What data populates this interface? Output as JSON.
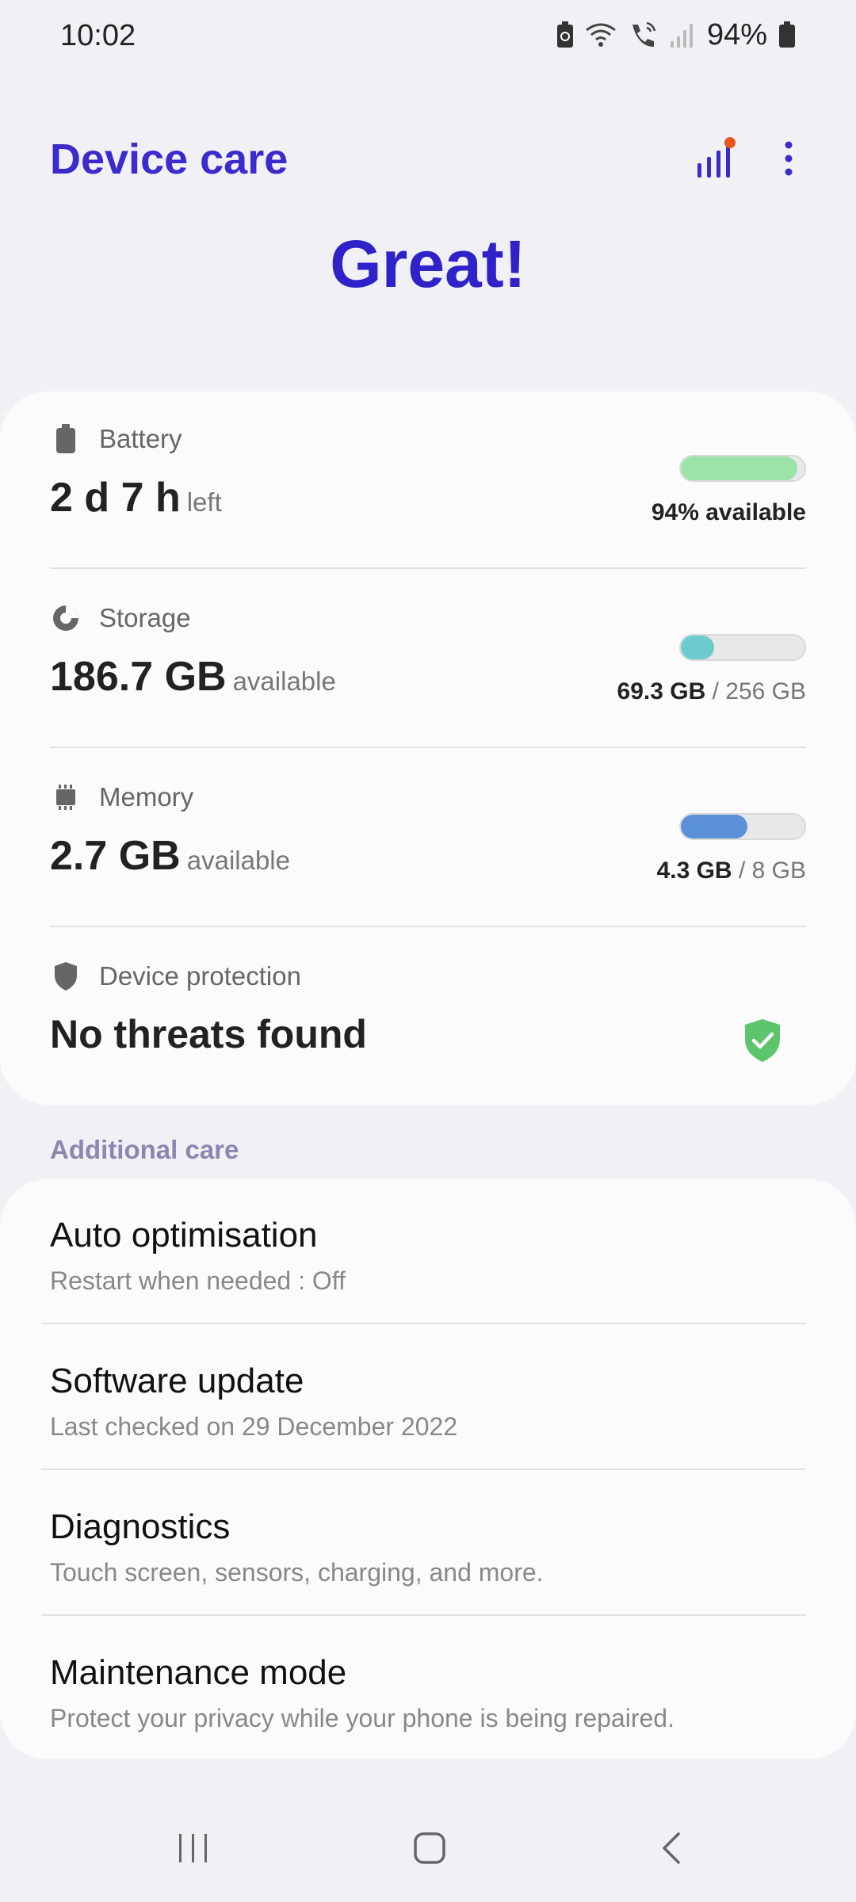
{
  "status_bar": {
    "time": "10:02",
    "battery_percent_text": "94%"
  },
  "header": {
    "title": "Device care",
    "headline": "Great!"
  },
  "battery": {
    "label": "Battery",
    "value": "2 d 7 h",
    "suffix": "left",
    "right_text": "94% available",
    "level": 0.94,
    "bar_color": "#9be3a8"
  },
  "storage": {
    "label": "Storage",
    "value": "186.7 GB",
    "suffix": "available",
    "used": "69.3 GB",
    "total": "/ 256 GB",
    "level": 0.27,
    "bar_color": "#6ccbcc"
  },
  "memory": {
    "label": "Memory",
    "value": "2.7 GB",
    "suffix": "available",
    "used": "4.3 GB",
    "total": "/ 8 GB",
    "level": 0.54,
    "bar_color": "#5b8fd8"
  },
  "protection": {
    "label": "Device protection",
    "value": "No threats found"
  },
  "additional_care": {
    "section_title": "Additional care",
    "items": [
      {
        "title": "Auto optimisation",
        "subtitle": "Restart when needed : Off"
      },
      {
        "title": "Software update",
        "subtitle": "Last checked on 29 December 2022"
      },
      {
        "title": "Diagnostics",
        "subtitle": "Touch screen, sensors, charging, and more."
      },
      {
        "title": "Maintenance mode",
        "subtitle": "Protect your privacy while your phone is being repaired."
      }
    ]
  },
  "colors": {
    "accent": "#3a2bcc",
    "background": "#f0f0f5",
    "card": "#fbfbfb",
    "shield_green": "#5cc46a"
  },
  "icons": [
    "battery-saver-icon",
    "wifi-icon",
    "wifi-calling-icon",
    "signal-icon",
    "battery-icon",
    "stats-icon",
    "more-options-icon",
    "battery-icon",
    "storage-icon",
    "memory-icon",
    "shield-icon",
    "shield-check-icon",
    "recents-icon",
    "home-icon",
    "back-icon"
  ]
}
